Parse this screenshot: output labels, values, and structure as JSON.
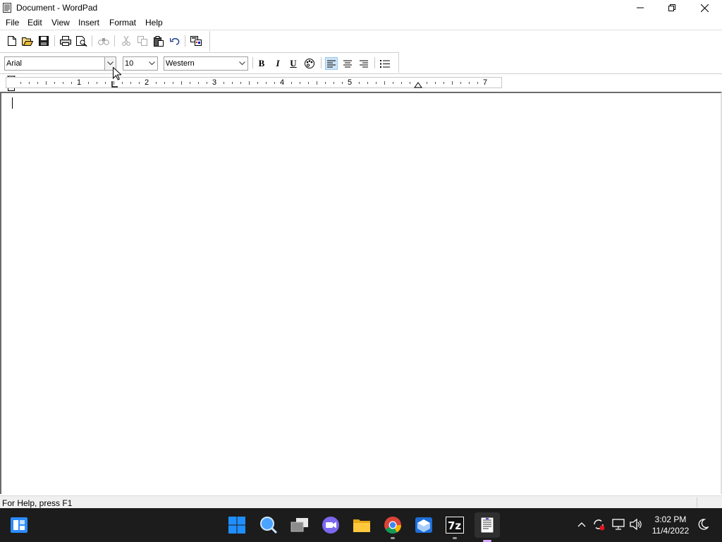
{
  "window": {
    "title": "Document - WordPad"
  },
  "menu": {
    "items": [
      {
        "label": "File"
      },
      {
        "label": "Edit"
      },
      {
        "label": "View"
      },
      {
        "label": "Insert"
      },
      {
        "label": "Format"
      },
      {
        "label": "Help"
      }
    ]
  },
  "toolbar": {
    "icons": [
      "new-icon",
      "open-icon",
      "save-icon",
      "print-icon",
      "print-preview-icon",
      "find-icon",
      "cut-icon",
      "copy-icon",
      "paste-icon",
      "undo-icon",
      "insert-object-icon"
    ]
  },
  "format": {
    "font": "Arial",
    "size": "10",
    "script": "Western",
    "bold": "B",
    "italic": "I",
    "underline": "U",
    "alignment": "left"
  },
  "ruler": {
    "numbers": [
      "1",
      "2",
      "3",
      "4",
      "5",
      "7"
    ]
  },
  "document": {
    "content": ""
  },
  "status": {
    "text": "For Help, press F1"
  },
  "taskbar": {
    "time": "3:02 PM",
    "date": "11/4/2022"
  },
  "colors": {
    "taskbar_bg": "#1c1c1c",
    "active_button_bg": "#cce4f7",
    "windows_blue": "#1f8fff"
  }
}
